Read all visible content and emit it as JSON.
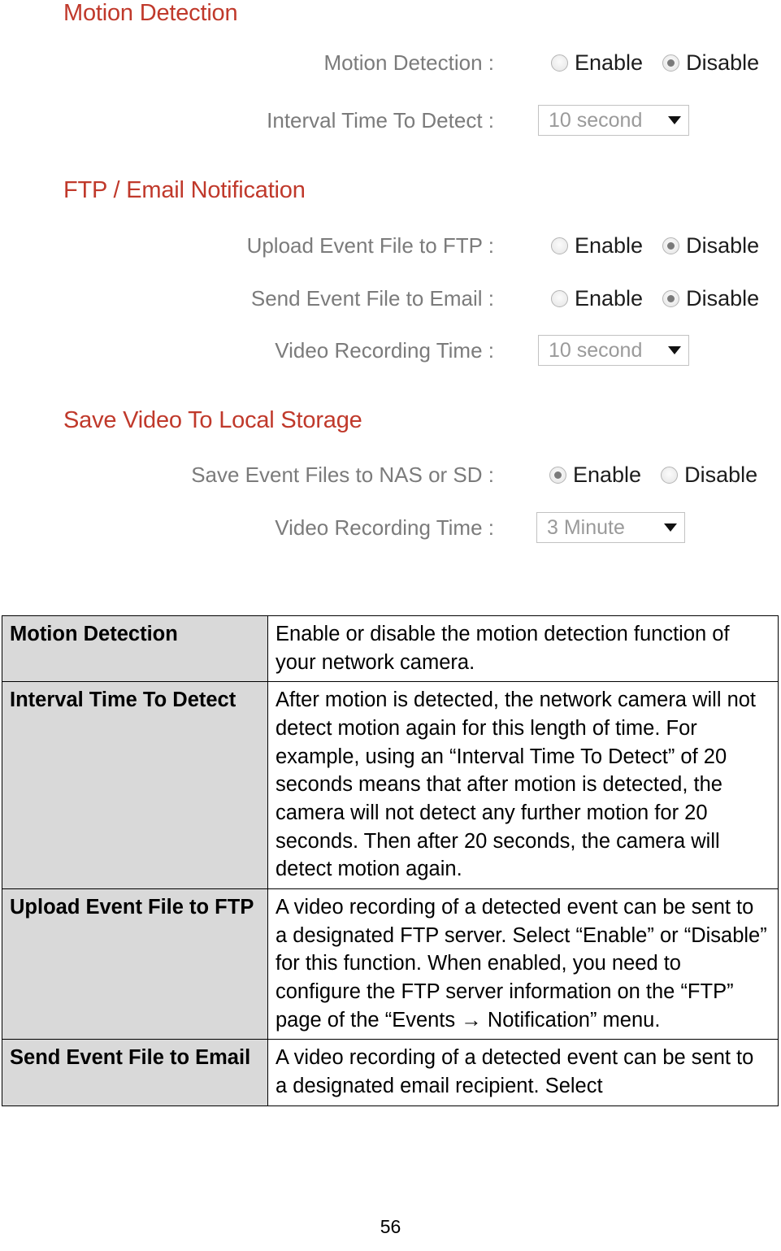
{
  "screenshot": {
    "sections": [
      {
        "heading": "Motion Detection",
        "rows": [
          {
            "label": "Motion Detection :",
            "control": "radio",
            "options": [
              {
                "text": "Enable",
                "checked": false
              },
              {
                "text": "Disable",
                "checked": true
              }
            ]
          },
          {
            "label": "Interval Time To Detect :",
            "control": "select",
            "value": "10 second"
          }
        ]
      },
      {
        "heading": "FTP / Email Notification",
        "rows": [
          {
            "label": "Upload Event File to FTP :",
            "control": "radio",
            "options": [
              {
                "text": "Enable",
                "checked": false
              },
              {
                "text": "Disable",
                "checked": true
              }
            ]
          },
          {
            "label": "Send Event File to Email :",
            "control": "radio",
            "options": [
              {
                "text": "Enable",
                "checked": false
              },
              {
                "text": "Disable",
                "checked": true
              }
            ]
          },
          {
            "label": "Video Recording Time :",
            "control": "select",
            "value": "10 second"
          }
        ]
      },
      {
        "heading": "Save Video To Local Storage",
        "rows": [
          {
            "label": "Save Event Files to NAS or SD :",
            "control": "radio",
            "options": [
              {
                "text": "Enable",
                "checked": true
              },
              {
                "text": "Disable",
                "checked": false
              }
            ]
          },
          {
            "label": "Video Recording Time :",
            "control": "select",
            "value": "3 Minute"
          }
        ]
      }
    ]
  },
  "table": {
    "rows": [
      {
        "key": "Motion Detection",
        "value": "Enable or disable the motion detection function of your network camera."
      },
      {
        "key": "Interval Time To Detect",
        "value": "After motion is detected, the network camera will not detect motion again for this length of time. For example, using an “Interval Time To Detect” of 20 seconds means that after motion is detected, the camera will not detect any further motion for 20 seconds. Then after 20 seconds, the camera will detect motion again."
      },
      {
        "key": "Upload Event File to FTP",
        "value": "A video recording of a detected event can be sent to a designated FTP server. Select “Enable” or “Disable” for this function. When enabled, you need to configure the FTP server information on the “FTP” page of the “Events → Notification” menu."
      },
      {
        "key": "Send Event File to Email",
        "value": "A video recording of a detected event can be sent to a designated email recipient. Select"
      }
    ]
  },
  "footer": {
    "page_number": "56"
  },
  "colors": {
    "heading": "#c0392b",
    "label": "#7b7b7b",
    "key_cell_bg": "#d9d9d9"
  }
}
